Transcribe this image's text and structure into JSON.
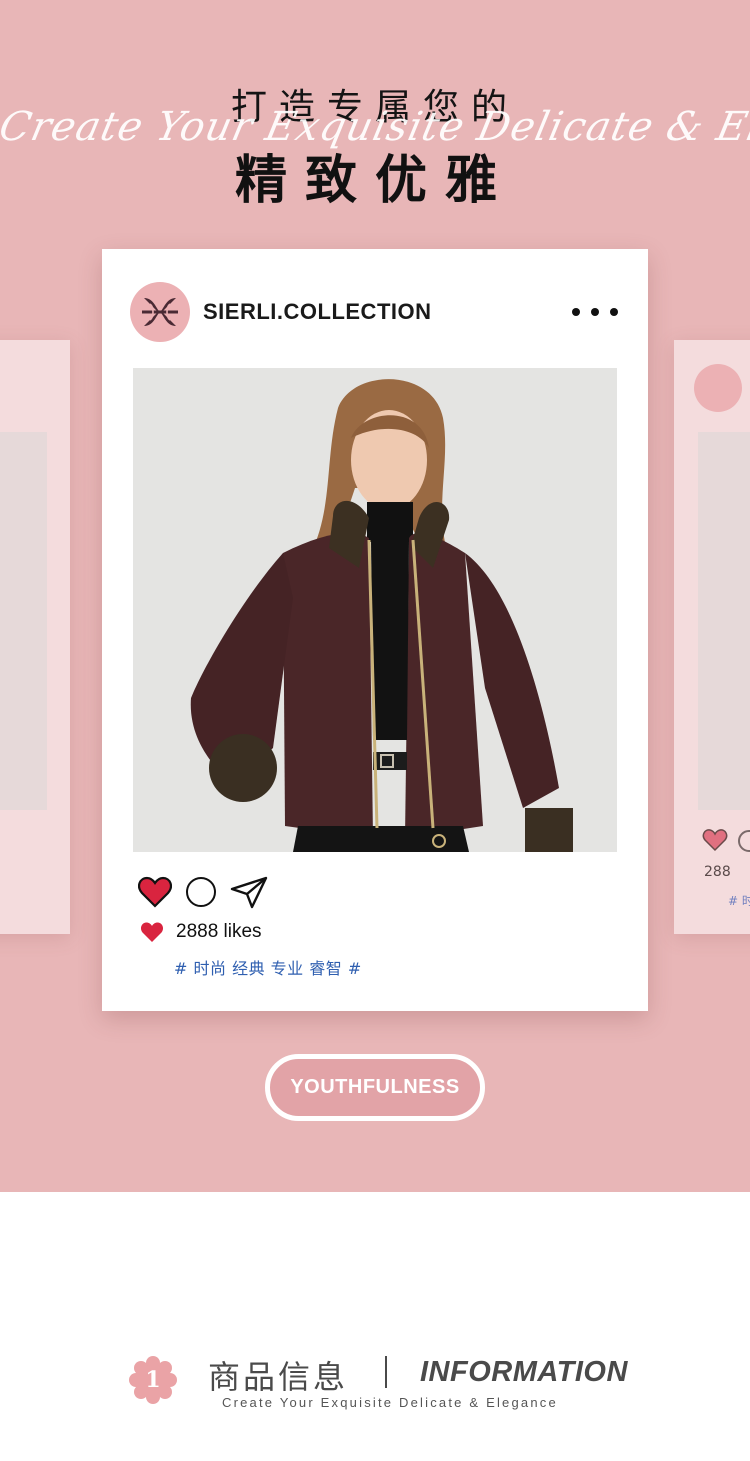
{
  "hero": {
    "title_line1": "打造专属您的",
    "script_text": "Create Your Exquisite Delicate & Elegance",
    "title_line2": "精致优雅"
  },
  "post": {
    "account_name": "SIERLI.COLLECTION",
    "more_icon": "more-dots-icon",
    "photo_alt": "woman wearing burgundy zip jacket with fur collar and cuffs",
    "likes_text": "2888 likes",
    "hashtags": "# 时尚 经典 专业 睿智 #",
    "icons": [
      "heart-icon",
      "comment-icon",
      "share-icon"
    ]
  },
  "ghost_right": {
    "likes_text": "288",
    "tag_text": "# 时"
  },
  "tag_button": {
    "label": "YOUTHFULNESS"
  },
  "section": {
    "badge_number": "1",
    "title_cn": "商品信息",
    "title_en": "INFORMATION",
    "subtitle": "Create Your Exquisite Delicate & Elegance"
  },
  "colors": {
    "background_pink": "#e8b6b7",
    "accent_pink": "#ecb1b4",
    "heart_red": "#d9243f",
    "tag_blue": "#2f5fb0"
  }
}
